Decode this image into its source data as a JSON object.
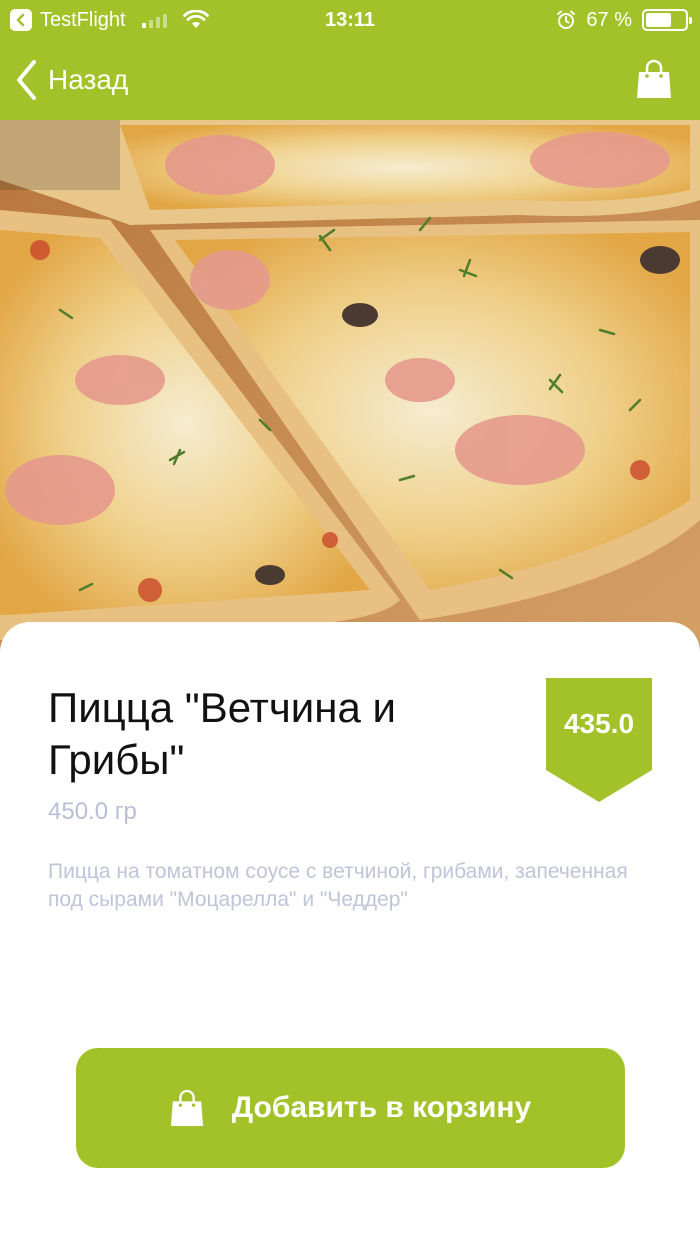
{
  "status_bar": {
    "carrier": "TestFlight",
    "time": "13:11",
    "battery_percent": "67 %",
    "battery_level": 0.67
  },
  "nav": {
    "back_label": "Назад",
    "back_icon": "chevron-left-icon",
    "cart_icon": "shopping-bag-icon"
  },
  "product": {
    "title": "Пицца \"Ветчина и Грибы\"",
    "weight": "450.0 гр",
    "price": "435.0",
    "description": "Пицца на томатном  соусе с ветчиной, грибами, запеченная под сырами \"Моцарелла\" и \"Чеддер\"",
    "image_subject": "pizza with ham, mushrooms, cheese and dill"
  },
  "actions": {
    "add_to_cart_label": "Добавить в корзину"
  },
  "colors": {
    "brand_green": "#a3c229",
    "text_dark": "#111111",
    "text_muted": "#b8bfd6"
  }
}
